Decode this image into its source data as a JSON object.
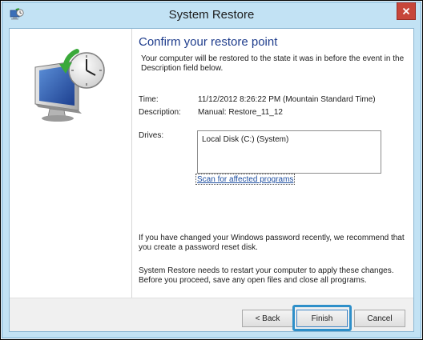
{
  "window": {
    "title": "System Restore",
    "accent_color": "#c2e2f4",
    "close_icon": "close-icon"
  },
  "main": {
    "heading": "Confirm your restore point",
    "intro": "Your computer will be restored to the state it was in before the event in the Description field below.",
    "fields": {
      "time_label": "Time:",
      "time_value": "11/12/2012 8:26:22 PM (Mountain Standard Time)",
      "description_label": "Description:",
      "description_value": "Manual: Restore_11_12",
      "drives_label": "Drives:",
      "drives": [
        "Local Disk (C:) (System)"
      ]
    },
    "scan_link": "Scan for affected programs",
    "password_note": "If you have changed your Windows password recently, we recommend that you create a password reset disk.",
    "restart_note": "System Restore needs to restart your computer to apply these changes. Before you proceed, save any open files and close all programs."
  },
  "footer": {
    "back_label": "< Back",
    "finish_label": "Finish",
    "cancel_label": "Cancel",
    "highlight_color": "#2e8fc9"
  }
}
